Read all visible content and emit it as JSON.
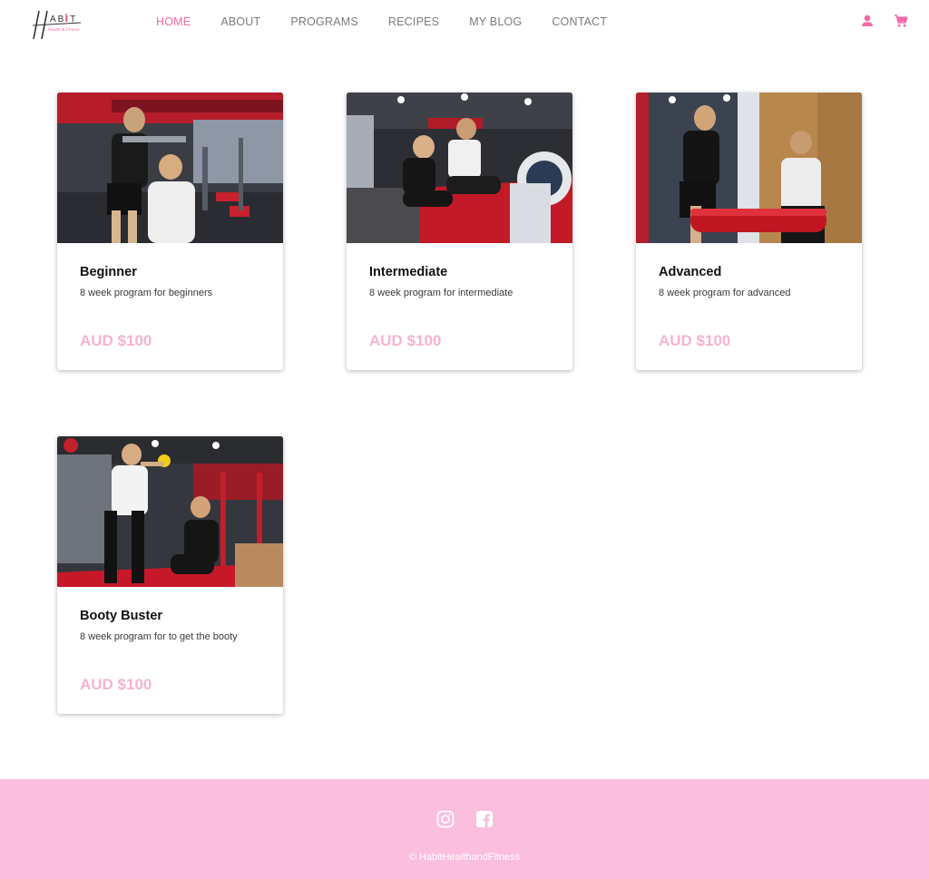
{
  "header": {
    "logo_text": "HABIT",
    "logo_tagline": "Health & Fitness",
    "nav": [
      {
        "label": "HOME"
      },
      {
        "label": "ABOUT"
      },
      {
        "label": "PROGRAMS"
      },
      {
        "label": "RECIPES"
      },
      {
        "label": "MY BLOG"
      },
      {
        "label": "CONTACT"
      }
    ],
    "active_nav": "HOME",
    "icons": [
      "user-icon",
      "cart-icon"
    ]
  },
  "programs": [
    {
      "title": "Beginner",
      "description": "8 week program for beginners",
      "price": "AUD $100"
    },
    {
      "title": "Intermediate",
      "description": "8 week program for intermediate",
      "price": "AUD $100"
    },
    {
      "title": "Advanced",
      "description": "8 week program for advanced",
      "price": "AUD $100"
    },
    {
      "title": "Booty Buster",
      "description": "8 week program for to get the booty",
      "price": "AUD $100"
    }
  ],
  "footer": {
    "social_icons": [
      "instagram-icon",
      "facebook-icon"
    ],
    "copyright": "© HabitHealthandFitness"
  },
  "colors": {
    "accent": "#f36aa8",
    "price": "#f7b3d2",
    "footer_bg": "#fbbedc",
    "nav_text": "#7c7c7c"
  }
}
